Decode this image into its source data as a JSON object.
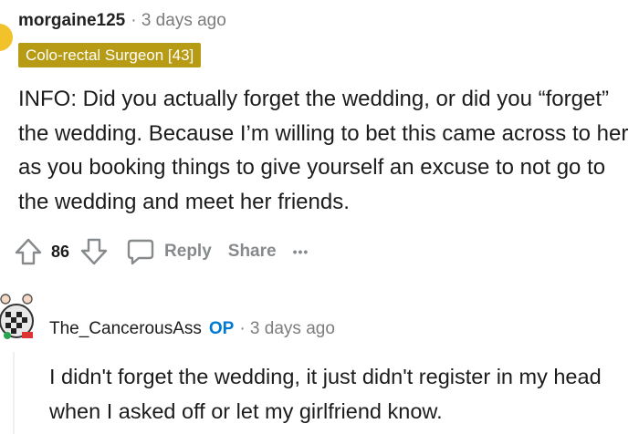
{
  "comment1": {
    "username": "morgaine125",
    "time": "· 3 days ago",
    "flair": "Colo-rectal Surgeon [43]",
    "body": "INFO: Did you actually forget the wedding, or did you “forget” the wedding. Because I’m willing to bet this came across to her as you booking things to give yourself an excuse to not go to the wedding and meet her friends.",
    "votes": "86",
    "reply_label": "Reply",
    "share_label": "Share",
    "more_label": "•••"
  },
  "comment2": {
    "username": "The_CancerousAss",
    "op_badge": "OP",
    "time": "· 3 days ago",
    "body": "I didn't forget the wedding, it just didn't register in my head when I asked off or let my girlfriend know."
  },
  "icons": [
    "upvote-icon",
    "downvote-icon",
    "comment-icon",
    "more-icon"
  ],
  "colors": {
    "flair_bg": "#b89b14",
    "op_blue": "#0079d3",
    "meta_gray": "#7c7c7c",
    "avatar_yellow": "#f2c22b"
  }
}
